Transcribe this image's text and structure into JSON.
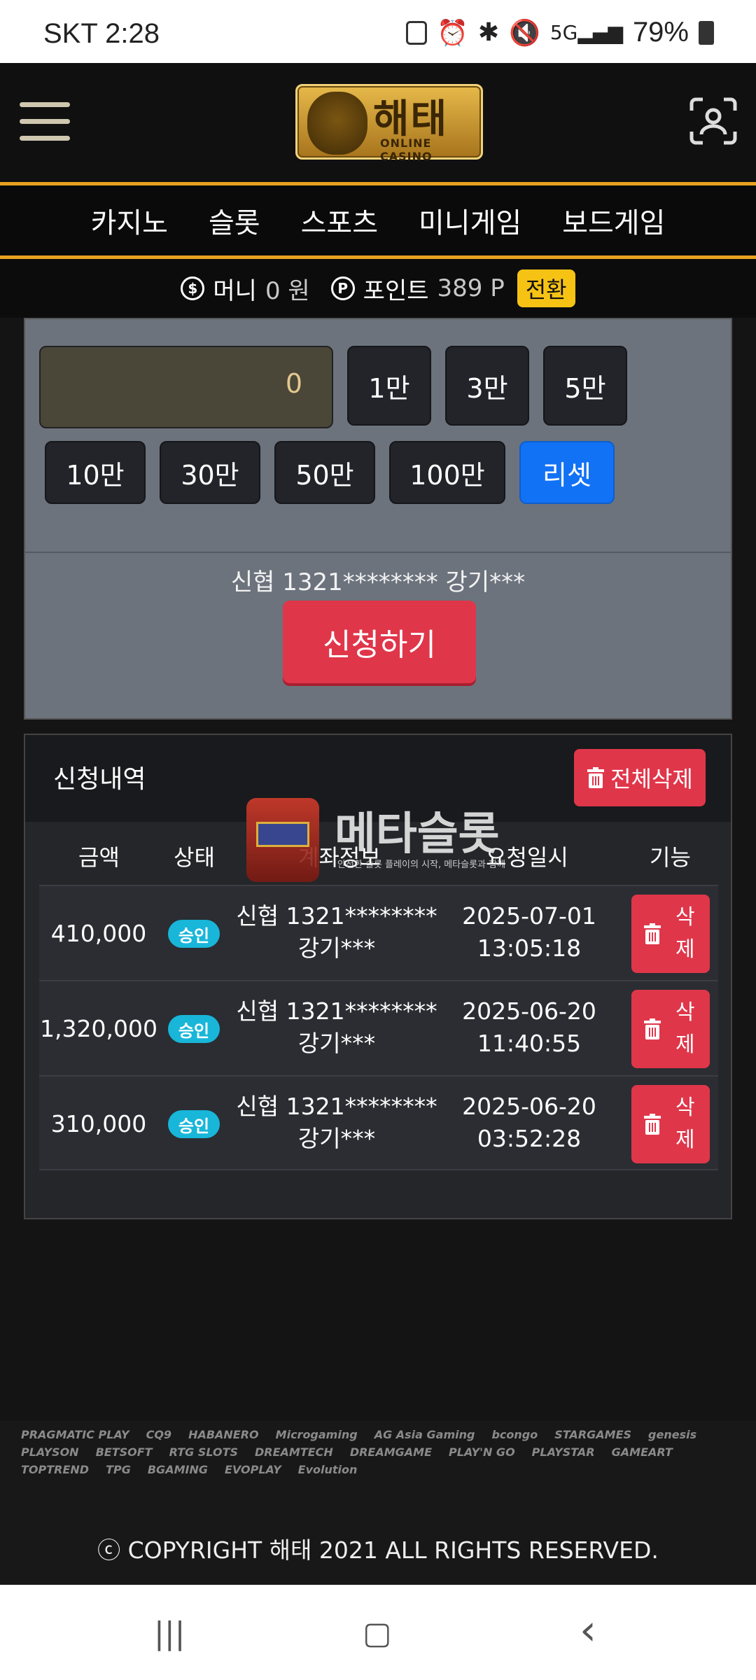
{
  "status": {
    "carrier_time": "SKT 2:28",
    "battery": "79%"
  },
  "logo": {
    "korean": "해태",
    "english": "ONLINE CASINO"
  },
  "nav": {
    "items": [
      "카지노",
      "슬롯",
      "스포츠",
      "미니게임",
      "보드게임"
    ]
  },
  "balance": {
    "money_label": "머니",
    "money_value": "0 원",
    "point_label": "포인트",
    "point_value": "389 P",
    "convert": "전환"
  },
  "form": {
    "amount_value": "0",
    "amount_buttons": [
      "1만",
      "3만",
      "5만",
      "10만",
      "30만",
      "50만",
      "100만"
    ],
    "reset": "리셋",
    "account": "신협 1321******** 강기***",
    "apply": "신청하기"
  },
  "history": {
    "title": "신청내역",
    "delete_all": "전체삭제",
    "columns": [
      "금액",
      "상태",
      "계좌정보",
      "요청일시",
      "기능"
    ],
    "rows": [
      {
        "amount": "410,000",
        "status": "승인",
        "account_line1": "신협 1321********",
        "account_line2": "강기***",
        "date": "2025-07-01",
        "time": "13:05:18",
        "delete": "삭제"
      },
      {
        "amount": "1,320,000",
        "status": "승인",
        "account_line1": "신협 1321********",
        "account_line2": "강기***",
        "date": "2025-06-20",
        "time": "11:40:55",
        "delete": "삭제"
      },
      {
        "amount": "310,000",
        "status": "승인",
        "account_line1": "신협 1321********",
        "account_line2": "강기***",
        "date": "2025-06-20",
        "time": "03:52:28",
        "delete": "삭제"
      }
    ]
  },
  "watermark": {
    "brand": "메타슬롯",
    "tagline": "안전한 슬롯 플레이의 시작, 메타슬롯과 함께"
  },
  "footer": {
    "provider_logos": [
      "PRAGMATIC PLAY",
      "CQ9",
      "HABANERO",
      "Microgaming",
      "AG Asia Gaming",
      "bcongo",
      "STARGAMES",
      "genesis",
      "PLAYSON",
      "BETSOFT",
      "RTG SLOTS",
      "DREAMTECH",
      "DREAMGAME",
      "PLAY'N GO",
      "PLAYSTAR",
      "GAMEART",
      "TOPTREND",
      "TPG",
      "BGAMING",
      "EVOPLAY",
      "Evolution"
    ],
    "copyright": "ⓒ COPYRIGHT 해태 2021 ALL RIGHTS RESERVED."
  },
  "system_nav": {
    "recent": "|||",
    "home": "▢",
    "back": "‹"
  }
}
